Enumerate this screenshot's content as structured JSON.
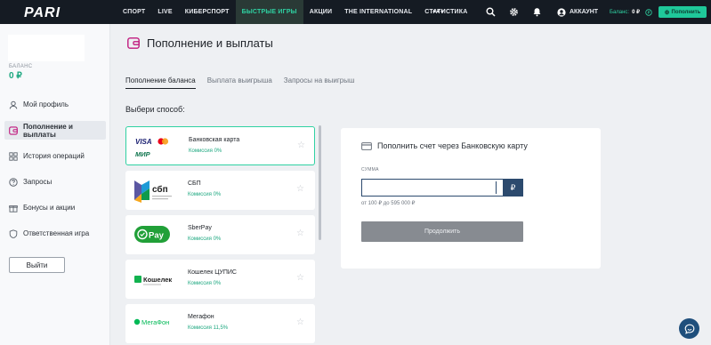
{
  "logo": {
    "text": "PARI"
  },
  "nav": {
    "items": [
      {
        "label": "СПОРТ",
        "active": false
      },
      {
        "label": "LIVE",
        "active": false
      },
      {
        "label": "КИБЕРСПОРТ",
        "active": false
      },
      {
        "label": "БЫСТРЫЕ ИГРЫ",
        "active": true
      },
      {
        "label": "АКЦИИ",
        "active": false
      },
      {
        "label": "THE INTERNATIONAL",
        "active": false
      },
      {
        "label": "СТАТИСТИКА",
        "active": false
      }
    ],
    "more": "•••"
  },
  "header": {
    "account_label": "АККАУНТ",
    "balance_label": "Баланс:",
    "balance_value": "0 ₽",
    "deposit_label": "Пополнить",
    "accent": "#2fd1a2"
  },
  "sidebar": {
    "balance_label": "БАЛАНС",
    "balance_value": "0 ₽",
    "items": [
      {
        "label": "Мой профиль",
        "icon": "user-icon",
        "active": false
      },
      {
        "label": "Пополнение и выплаты",
        "icon": "wallet-icon",
        "active": true
      },
      {
        "label": "История операций",
        "icon": "grid-icon",
        "active": false
      },
      {
        "label": "Запросы",
        "icon": "help-icon",
        "active": false
      },
      {
        "label": "Бонусы и акции",
        "icon": "gift-icon",
        "active": false
      },
      {
        "label": "Ответственная игра",
        "icon": "shield-icon",
        "active": false
      }
    ],
    "logout_label": "Выйти"
  },
  "page": {
    "title": "Пополнение и выплаты",
    "tabs": [
      {
        "label": "Пополнение баланса",
        "active": true
      },
      {
        "label": "Выплата выигрыша",
        "active": false
      },
      {
        "label": "Запросы на выигрыш",
        "active": false
      }
    ],
    "choose_label": "Выбери способ:"
  },
  "methods": [
    {
      "name": "Банковская карта",
      "fee": "Комиссия 0%",
      "logo": "visa-mastercard-mir",
      "selected": true
    },
    {
      "name": "СБП",
      "fee": "Комиссия 0%",
      "logo": "sbp",
      "selected": false
    },
    {
      "name": "SberPay",
      "fee": "Комиссия 0%",
      "logo": "sberpay",
      "selected": false
    },
    {
      "name": "Кошелек ЦУПИС",
      "fee": "Комиссия 0%",
      "logo": "koshelek",
      "selected": false
    },
    {
      "name": "Мегафон",
      "fee": "Комиссия 11,5%",
      "logo": "megafon",
      "selected": false
    }
  ],
  "logo_text": {
    "visa": "VISA",
    "mir": "МИР",
    "sbp": "сбп",
    "sberpay": "Pay",
    "koshelek": "Кошелек",
    "megafon": "МегаФон"
  },
  "panel": {
    "title": "Пополнить счет через Банковскую карту",
    "sum_label": "СУММА",
    "sum_value": "",
    "currency": "₽",
    "range": "от 100 ₽ до 595 000 ₽",
    "continue_label": "Продолжить"
  }
}
